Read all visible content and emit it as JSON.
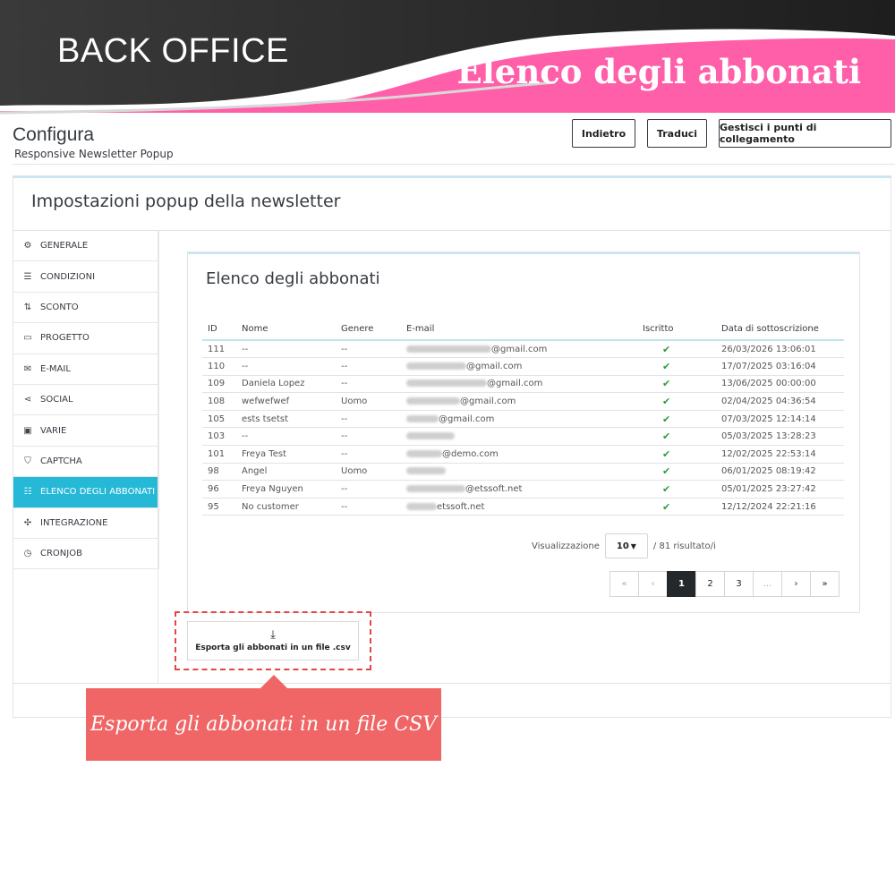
{
  "banner": {
    "left_text": "BACK OFFICE",
    "right_text": "Elenco degli abbonati"
  },
  "page": {
    "title": "Configura",
    "subtitle": "Responsive Newsletter Popup"
  },
  "header_buttons": {
    "back": "Indietro",
    "translate": "Traduci",
    "hooks": "Gestisci i punti di collegamento"
  },
  "panel": {
    "title": "Impostazioni popup della newsletter"
  },
  "sidebar": {
    "items": [
      {
        "label": "GENERALE",
        "icon": "cogs-icon"
      },
      {
        "label": "CONDIZIONI",
        "icon": "list-icon"
      },
      {
        "label": "SCONTO",
        "icon": "sort-icon"
      },
      {
        "label": "PROGETTO",
        "icon": "window-icon"
      },
      {
        "label": "E-MAIL",
        "icon": "envelope-icon"
      },
      {
        "label": "SOCIAL",
        "icon": "share-icon"
      },
      {
        "label": "VARIE",
        "icon": "monitor-icon"
      },
      {
        "label": "CAPTCHA",
        "icon": "shield-icon"
      },
      {
        "label": "ELENCO DEGLI ABBONATI",
        "icon": "list-icon",
        "active": true
      },
      {
        "label": "INTEGRAZIONE",
        "icon": "puzzle-icon"
      },
      {
        "label": "CRONJOB",
        "icon": "clock-icon"
      }
    ]
  },
  "card": {
    "title": "Elenco degli abbonati"
  },
  "table": {
    "headers": [
      "ID",
      "Nome",
      "Genere",
      "E-mail",
      "Iscritto",
      "Data di sottoscrizione"
    ],
    "rows": [
      {
        "id": "111",
        "name": "--",
        "gender": "--",
        "email_visible": "@gmail.com",
        "date": "26/03/2026 13:06:01"
      },
      {
        "id": "110",
        "name": "--",
        "gender": "--",
        "email_visible": "@gmail.com",
        "date": "17/07/2025 03:16:04"
      },
      {
        "id": "109",
        "name": "Daniela Lopez",
        "gender": "--",
        "email_visible": "@gmail.com",
        "date": "13/06/2025 00:00:00"
      },
      {
        "id": "108",
        "name": "wefwefwef",
        "gender": "Uomo",
        "email_visible": "@gmail.com",
        "date": "02/04/2025 04:36:54"
      },
      {
        "id": "105",
        "name": "ests tsetst",
        "gender": "--",
        "email_visible": "@gmail.com",
        "date": "07/03/2025 12:14:14"
      },
      {
        "id": "103",
        "name": "--",
        "gender": "--",
        "email_visible": "",
        "date": "05/03/2025 13:28:23"
      },
      {
        "id": "101",
        "name": "Freya Test",
        "gender": "--",
        "email_visible": "@demo.com",
        "date": "12/02/2025 22:53:14"
      },
      {
        "id": "98",
        "name": "Angel",
        "gender": "Uomo",
        "email_visible": "",
        "date": "06/01/2025 08:19:42"
      },
      {
        "id": "96",
        "name": "Freya Nguyen",
        "gender": "--",
        "email_visible": "@etssoft.net",
        "date": "05/01/2025 23:27:42"
      },
      {
        "id": "95",
        "name": "No customer",
        "gender": "--",
        "email_visible": "etssoft.net",
        "date": "12/12/2024 22:21:16"
      }
    ],
    "subscribed_icon": "check-icon"
  },
  "pagination": {
    "display_label": "Visualizzazione",
    "per_page": "10",
    "result_text": "/ 81 risultato/i",
    "pages": [
      "«",
      "‹",
      "1",
      "2",
      "3",
      "...",
      "›",
      "»"
    ],
    "current_page": "1"
  },
  "export": {
    "label": "Esporta gli abbonati in un file .csv",
    "icon": "download-icon"
  },
  "callout": {
    "text": "Esporta gli abbonati in un file CSV"
  },
  "colors": {
    "accent": "#25b9d7",
    "banner_pink": "#ff5fa8",
    "callout": "#f06565",
    "check": "#2e9c3f"
  }
}
